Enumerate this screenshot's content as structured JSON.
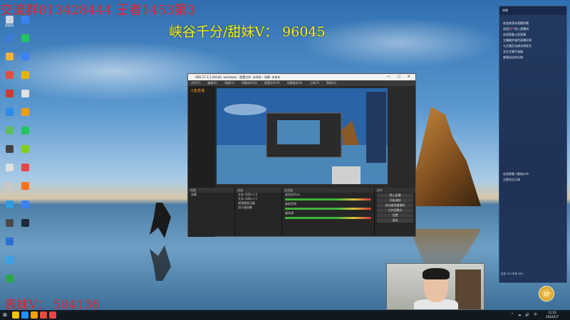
{
  "overlays": {
    "group_text": "交流群813428444 王者1453第3",
    "wechat_text": "峡谷千分/甜妹V：  96045",
    "cousin_text": "表妹V：  584136"
  },
  "desktop_icons": [
    {
      "name": "recycle",
      "label": "回收站",
      "color": "#cfd6e0"
    },
    {
      "name": "app2",
      "label": "",
      "color": "#3a7bd5"
    },
    {
      "name": "app3",
      "label": "",
      "color": "#f2b233"
    },
    {
      "name": "app4",
      "label": "",
      "color": "#e94b3c"
    },
    {
      "name": "app5",
      "label": "",
      "color": "#d13b2d"
    },
    {
      "name": "app6",
      "label": "",
      "color": "#2d8ce8"
    },
    {
      "name": "app7",
      "label": "",
      "color": "#5bbd5a"
    },
    {
      "name": "app8",
      "label": "",
      "color": "#444"
    },
    {
      "name": "app9",
      "label": "",
      "color": "#e0e0e0"
    },
    {
      "name": "app10",
      "label": "",
      "color": "#c9c9c9"
    },
    {
      "name": "app11",
      "label": "",
      "color": "#2f9be0"
    },
    {
      "name": "app12",
      "label": "",
      "color": "#4a4a4a"
    },
    {
      "name": "app13",
      "label": "",
      "color": "#2e6fd6"
    },
    {
      "name": "app14",
      "label": "",
      "color": "#3aa0e8"
    },
    {
      "name": "app15",
      "label": "",
      "color": "#28a745"
    },
    {
      "name": "app16",
      "label": "",
      "color": "#3b82f6"
    },
    {
      "name": "app17",
      "label": "",
      "color": "#22c55e"
    },
    {
      "name": "app18",
      "label": "",
      "color": "#3b82f6"
    },
    {
      "name": "app19",
      "label": "",
      "color": "#eab308"
    },
    {
      "name": "app20",
      "label": "",
      "color": "#e0e0e0"
    },
    {
      "name": "app21",
      "label": "",
      "color": "#f59e0b"
    },
    {
      "name": "app22",
      "label": "",
      "color": "#22c55e"
    },
    {
      "name": "app23",
      "label": "",
      "color": "#84cc16"
    },
    {
      "name": "app24",
      "label": "",
      "color": "#ef4444"
    },
    {
      "name": "app25",
      "label": "",
      "color": "#f97316"
    },
    {
      "name": "app26",
      "label": "",
      "color": "#3b82f6"
    },
    {
      "name": "app27",
      "label": "",
      "color": "#1f2937"
    }
  ],
  "obs": {
    "title": "OBS 27.1.3 (64-bit, windows) - 配置文件: 未命名 - 场景: 未命名",
    "controls": "— ▢ ✕",
    "menu": [
      "文件(F)",
      "编辑(E)",
      "视图(V)",
      "停靠部件(D)",
      "配置文件(P)",
      "场景集合(S)",
      "工具(T)",
      "帮助(H)"
    ],
    "brand": "斗鱼直播",
    "docks": {
      "scenes": {
        "title": "场景",
        "items": [
          "场景"
        ]
      },
      "sources": {
        "title": "来源",
        "items": [
          "文本 (GDI+) 3",
          "文本 (GDI+) 2",
          "视频捕获设备",
          "显示器采集"
        ]
      },
      "mixer": {
        "title": "混音器",
        "items": [
          "麦克风/Aux",
          "桌面音频",
          "媒体源"
        ]
      },
      "controls": {
        "title": "控件",
        "buttons": [
          "停止直播",
          "开始录制",
          "启动虚拟摄像机",
          "工作室模式",
          "设置",
          "退出"
        ]
      }
    }
  },
  "chat": {
    "header": "弹幕",
    "messages": [
      {
        "text": "欢迎来到本直播间哦"
      },
      {
        "text": "欢迎",
        "hl": "用户",
        "rest": "进入直播间"
      },
      {
        "text": "欢迎观看斗鱼直播"
      },
      {
        "text": "主播维护绿色直播环境"
      },
      {
        "text": "与主播互动请文明发言"
      },
      {
        "text": "关注主播不迷路"
      },
      {
        "text": "感谢送出的礼物"
      }
    ],
    "bottom_messages": [
      {
        "text": "在线观看人数统计中"
      },
      {
        "text": "点赞关注订阅"
      }
    ],
    "badge": "17",
    "stats": "在线 123  本场 456"
  },
  "taskbar": {
    "start_icon": "⊞",
    "apps": [
      "#f2c200",
      "#1e90ff",
      "#f59e0b",
      "#e74c3c",
      "#ef4444"
    ],
    "tray": "^ ☁ 🔊 中",
    "time": "11:53",
    "date": "2022/1/7"
  }
}
